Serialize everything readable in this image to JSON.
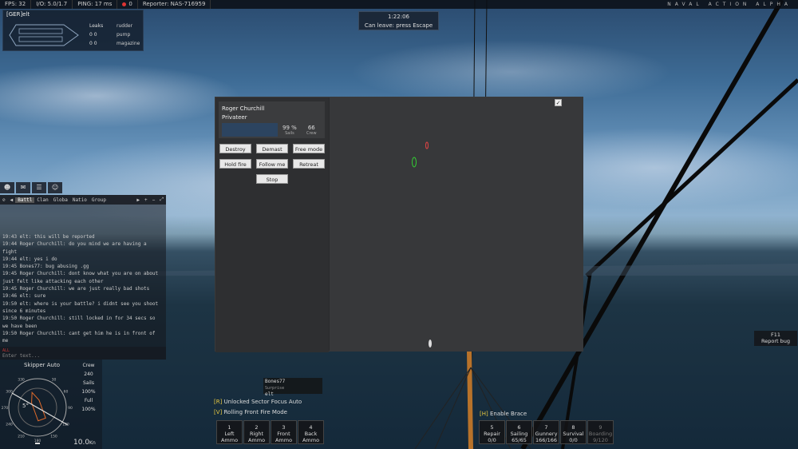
{
  "topbar": {
    "fps": "FPS: 32",
    "io": "I/O: 5.0/1.7",
    "ping": "PING: 17 ms",
    "rec": "0",
    "reporter": "Reporter: NAS-716959",
    "brand": "NAVAL ACTION ALPHA"
  },
  "ship_status": {
    "name": "[GER]elt",
    "leaks_label": "Leaks",
    "leak_row1": "0  0",
    "leak_row2": "0  0",
    "systems": [
      "rudder",
      "pump",
      "magazine"
    ]
  },
  "battle_timer": {
    "time": "1:22:06",
    "leave_text": "Can leave: press Escape"
  },
  "fleet_panel": {
    "captain": "Roger Churchill",
    "ship_class": "Privateer",
    "sails_value": "99 %",
    "sails_label": "Sails",
    "crew_value": "66",
    "crew_label": "Crew",
    "buttons": {
      "destroy": "Destroy",
      "demast": "Demast",
      "free_mode": "Free mode",
      "hold_fire": "Hold fire",
      "follow_me": "Follow me",
      "retreat": "Retreat",
      "stop": "Stop"
    },
    "check": "✓"
  },
  "chat": {
    "tabs": [
      "Battl",
      "Clan",
      "Globa",
      "Natio",
      "Group"
    ],
    "messages": [
      "19:43 elt: this will be reported",
      "19:44 Roger Churchill: do you mind we are having a fight",
      "19:44 elt: yes i do",
      "19:45 Bones77: bug abusing .gg",
      "19:45 Roger Churchill: dont know what you are on about just felt like attacking each other",
      "19:45 Roger Churchill: we are just really bad shots",
      "19:46 elt: sure",
      "19:50 elt: where is your battle? i didnt see you shoot since 6 minutes",
      "19:50 Roger Churchill: still locked in for 34 secs so we have been",
      "19:50 Roger Churchill: cant get him he is in front of me"
    ],
    "channel": "ALL",
    "input_placeholder": "Enter text..."
  },
  "helm": {
    "mode": "Skipper Auto",
    "heading": "5°",
    "speed": "10.0",
    "speed_unit": "Kn",
    "compass_ticks": [
      "30",
      "60",
      "90",
      "120",
      "150",
      "180",
      "210",
      "240",
      "270",
      "300",
      "330"
    ],
    "crew_label": "Crew",
    "crew_value": "240",
    "sails_label": "Sails",
    "sails_value": "100%",
    "full_label": "Full",
    "full_value": "100%"
  },
  "sector": {
    "line1_key": "[R]",
    "line1_text": "Unlocked Sector Focus Auto",
    "line2_key": "[V]",
    "line2_text": "Rolling Front Fire Mode"
  },
  "target_names": {
    "name1": "Bones77",
    "ship1": "Surprise",
    "name2": "elt"
  },
  "ammo": [
    {
      "num": "1",
      "label": "Left",
      "sub": "Ammo"
    },
    {
      "num": "2",
      "label": "Right",
      "sub": "Ammo"
    },
    {
      "num": "3",
      "label": "Front",
      "sub": "Ammo"
    },
    {
      "num": "4",
      "label": "Back",
      "sub": "Ammo"
    }
  ],
  "brace": {
    "key": "[H]",
    "text": "Enable Brace"
  },
  "skills": [
    {
      "num": "5",
      "label": "Repair",
      "value": "0/0"
    },
    {
      "num": "6",
      "label": "Sailing",
      "value": "65/65"
    },
    {
      "num": "7",
      "label": "Gunnery",
      "value": "166/166"
    },
    {
      "num": "8",
      "label": "Survival",
      "value": "0/0"
    },
    {
      "num": "9",
      "label": "Boarding",
      "value": "9/120"
    }
  ],
  "report": {
    "key": "F11",
    "label": "Report bug"
  },
  "colors": {
    "accent_yellow": "#e8c840",
    "panel": "#2a2b2d",
    "sea": "#1d3444"
  }
}
